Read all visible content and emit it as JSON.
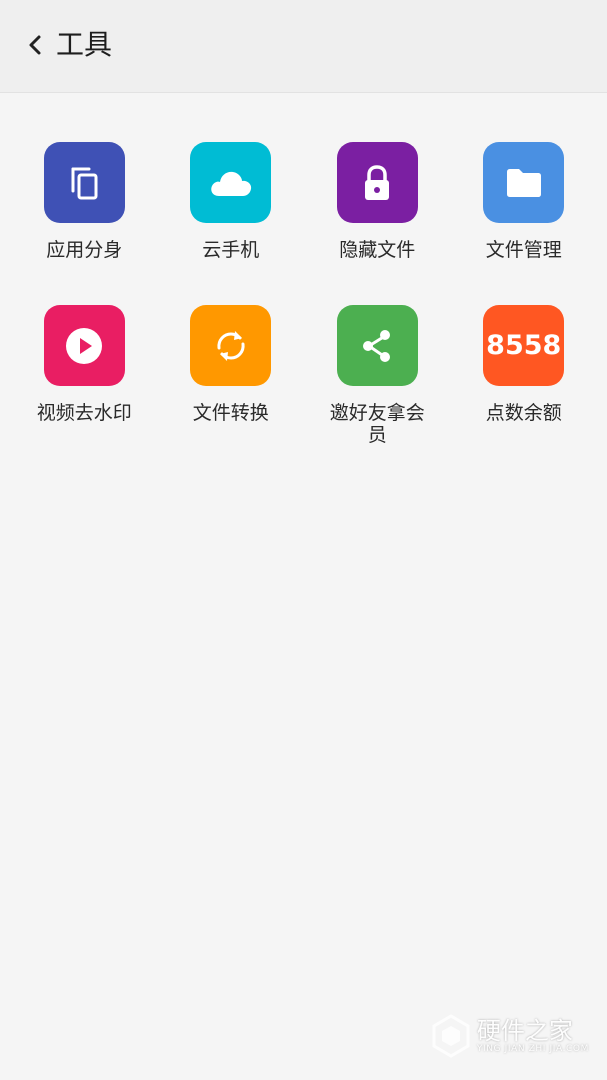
{
  "header": {
    "title": "工具"
  },
  "tools": [
    {
      "label": "应用分身",
      "color": "#3f51b5",
      "icon": "copy-icon"
    },
    {
      "label": "云手机",
      "color": "#00bcd4",
      "icon": "cloud-icon"
    },
    {
      "label": "隐藏文件",
      "color": "#7b1fa2",
      "icon": "lock-icon"
    },
    {
      "label": "文件管理",
      "color": "#4a90e2",
      "icon": "folder-icon"
    },
    {
      "label": "视频去水印",
      "color": "#e91e63",
      "icon": "play-icon"
    },
    {
      "label": "文件转换",
      "color": "#ff9800",
      "icon": "sync-icon"
    },
    {
      "label": "邀好友拿会员",
      "color": "#4caf50",
      "icon": "share-icon"
    },
    {
      "label": "点数余额",
      "color": "#ff5722",
      "icon": "balance-number",
      "value": "8558"
    }
  ],
  "watermark": {
    "main": "硬件之家",
    "sub": "YING JIAN ZHI JIA.COM"
  }
}
